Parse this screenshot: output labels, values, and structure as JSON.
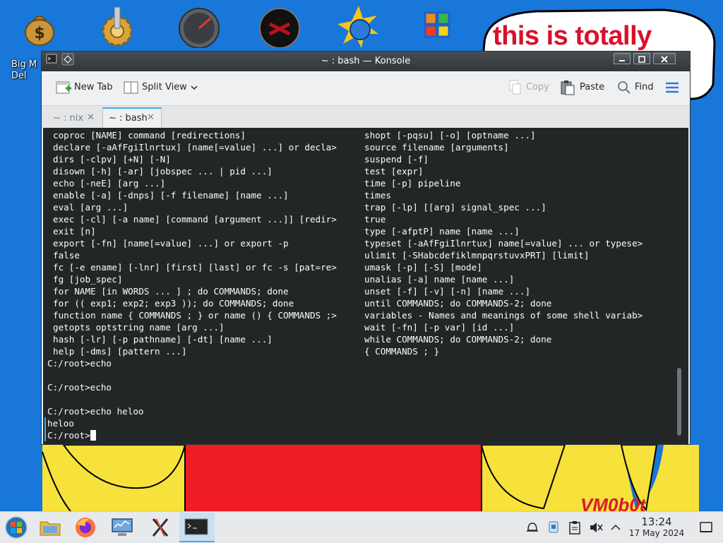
{
  "desktop": {
    "icons": [
      {
        "name": "big-money-icon",
        "label": "Big M Del"
      },
      {
        "name": "settings-gear-icon",
        "label": ""
      },
      {
        "name": "speedometer-icon",
        "label": ""
      },
      {
        "name": "red-skull-icon",
        "label": ""
      },
      {
        "name": "sun-globe-icon",
        "label": ""
      },
      {
        "name": "control-panel-icon",
        "label": ""
      }
    ],
    "bubble_text": "this is totally",
    "watermark": "VM0b0t"
  },
  "window": {
    "title": "~ : bash — Konsole",
    "toolbar": {
      "new_tab": "New Tab",
      "split_view": "Split View",
      "copy": "Copy",
      "paste": "Paste",
      "find": "Find"
    },
    "tabs": [
      {
        "label": "~ : nix",
        "active": false
      },
      {
        "label": "~ : bash",
        "active": true
      }
    ]
  },
  "terminal": {
    "left_column": [
      "coproc [NAME] command [redirections]",
      "declare [-aAfFgiIlnrtux] [name[=value] ...] or decla>",
      "dirs [-clpv] [+N] [-N]",
      "disown [-h] [-ar] [jobspec ... | pid ...]",
      "echo [-neE] [arg ...]",
      "enable [-a] [-dnps] [-f filename] [name ...]",
      "eval [arg ...]",
      "exec [-cl] [-a name] [command [argument ...]] [redir>",
      "exit [n]",
      "export [-fn] [name[=value] ...] or export -p",
      "false",
      "fc [-e ename] [-lnr] [first] [last] or fc -s [pat=re>",
      "fg [job_spec]",
      "for NAME [in WORDS ... ] ; do COMMANDS; done",
      "for (( exp1; exp2; exp3 )); do COMMANDS; done",
      "function name { COMMANDS ; } or name () { COMMANDS ;>",
      "getopts optstring name [arg ...]",
      "hash [-lr] [-p pathname] [-dt] [name ...]",
      "help [-dms] [pattern ...]"
    ],
    "right_column": [
      "shopt [-pqsu] [-o] [optname ...]",
      "source filename [arguments]",
      "suspend [-f]",
      "test [expr]",
      "time [-p] pipeline",
      "times",
      "trap [-lp] [[arg] signal_spec ...]",
      "true",
      "type [-afptP] name [name ...]",
      "typeset [-aAfFgiIlnrtux] name[=value] ... or typese>",
      "ulimit [-SHabcdefiklmnpqrstuvxPRT] [limit]",
      "umask [-p] [-S] [mode]",
      "unalias [-a] name [name ...]",
      "unset [-f] [-v] [-n] [name ...]",
      "until COMMANDS; do COMMANDS-2; done",
      "variables - Names and meanings of some shell variab>",
      "wait [-fn] [-p var] [id ...]",
      "while COMMANDS; do COMMANDS-2; done",
      "{ COMMANDS ; }"
    ],
    "session_lines": [
      "C:/root>echo",
      "",
      "C:/root>echo",
      "",
      "C:/root>echo heloo",
      "heloo"
    ],
    "current_prompt": "C:/root>"
  },
  "taskbar": {
    "apps": [
      {
        "name": "start-menu-icon"
      },
      {
        "name": "file-manager-icon"
      },
      {
        "name": "firefox-icon"
      },
      {
        "name": "system-monitor-icon"
      },
      {
        "name": "x-app-icon"
      },
      {
        "name": "konsole-icon",
        "active": true
      }
    ],
    "clock_time": "13:24",
    "clock_date": "17 May 2024"
  },
  "colors": {
    "accent": "#3daee9",
    "terminal_bg": "#232627",
    "terminal_fg": "#fcfcfc",
    "desktop_bg": "#1877d8"
  }
}
